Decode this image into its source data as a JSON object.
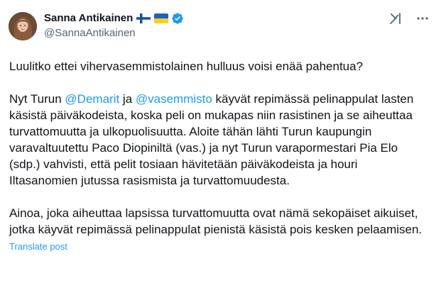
{
  "author": {
    "display_name": "Sanna Antikainen",
    "handle": "@SannaAntikainen",
    "flags": [
      "finland-flag",
      "ukraine-flag"
    ],
    "verified": true,
    "verified_color": "#1d9bf0"
  },
  "header_actions": {
    "grok_icon": "grok-icon",
    "more_icon": "more-horizontal-icon"
  },
  "post": {
    "p1": "Luulitko ettei vihervasemmistolainen hulluus voisi enää pahentua?",
    "p2_a": "Nyt Turun ",
    "p2_mention1": "@Demarit",
    "p2_b": " ja ",
    "p2_mention2": "@vasemmisto",
    "p2_c": " käyvät repimässä pelinappulat lasten käsistä päiväkodeista, koska peli on mukapas niin rasistinen ja se aiheuttaa turvattomuutta ja ulkopuolisuutta. Aloite tähän lähti Turun kaupungin varavaltuutettu Paco Diopiniltä (vas.) ja nyt Turun varapormestari Pia Elo (sdp.) vahvisti, että pelit tosiaan hävitetään päiväkodeista ja houri Iltasanomien jutussa rasismista ja turvattomuudesta.",
    "p3": "Ainoa, joka aiheuttaa lapsissa turvattomuutta ovat nämä sekopäiset aikuiset, jotka käyvät repimässä pelinappulat pienistä käsistä pois kesken pelaamisen."
  },
  "translate_label": "Translate post",
  "colors": {
    "text": "#0f1419",
    "secondary": "#536471",
    "link": "#1d9bf0"
  }
}
